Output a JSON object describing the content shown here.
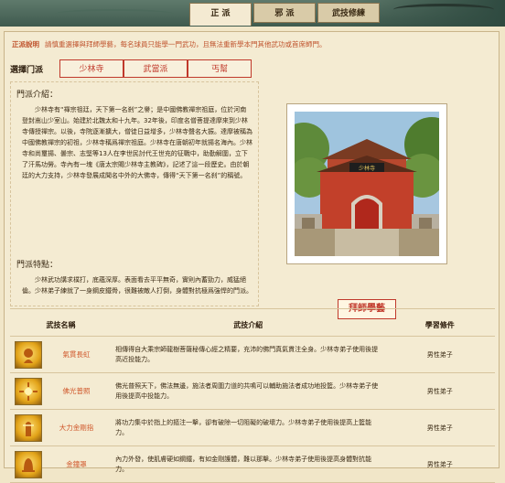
{
  "tabs": [
    {
      "label": "正 派",
      "active": true
    },
    {
      "label": "邪 派",
      "active": false
    },
    {
      "label": "武技修練",
      "active": false
    }
  ],
  "description": {
    "label": "正派說明",
    "text": "請慎重選擇與拜師學藝，每名球員只能學一門武功，且無法重新學本門其他武功或首席師門。"
  },
  "sect_selector": {
    "label": "選擇门派",
    "options": [
      "少林寺",
      "武當派",
      "丐幫"
    ]
  },
  "intro": {
    "heading": "門派介紹：",
    "body": "少林寺有“禪宗祖廷，天下第一名剎”之譽；是中國佛教禪宗祖庭，位於河南登封嵩山少室山。始建於北魏太和十九年。32年後，印度名僧菩提達摩來到少林寺傳授禪宗。以後，寺院逐漸擴大，僧徒日益增多，少林寺聲名大振。達摩被稱為中國佛教禪宗的初祖，少林寺稱爲禪宗祖庭。少林寺在唐朝初年就揚名海內。少林寺和尚璽揚、曇宗、志堅等13人在李世民討代王世充的征戰中，助勤解圍，立下了汗馬功勞。寺內有一塊《唐太宗賜少林寺主教碑》，記述了這一段歷史。由於朝廷的大力支持，少林寺發展成聞名中外的大佛寺，傳得“天下第一名刹”的稱號。"
  },
  "features": {
    "heading": "門派特點：",
    "body": "少林武功講求樸打，底蘊深厚。表面看去平平無奇，實則內蓄勁力，威猛絕倫。少林弟子練就了一身鋼皮鐵骨，很難被敵人打倒，身體對抗極爲強悍的門派。"
  },
  "apprentice_button": "拜師學藝",
  "skills_table": {
    "headers": [
      "武技名稱",
      "武技介紹",
      "學習條件"
    ],
    "rows": [
      {
        "icon": "fire-fist-icon",
        "name": "氣貫長虹",
        "intro": "相傳得自大乘宗師龍樹菩薩秘傳心經之精要，充沛的佛門真氣貫注全身。少林寺弟子使用後提高近投能力。",
        "condition": "男性弟子"
      },
      {
        "icon": "radiance-icon",
        "name": "佛光普照",
        "intro": "佛光普照天下，佛法無邊，施法者周圍力道的共鳴可以輔助施法者成功地投籃。少林寺弟子使用後提高中投能力。",
        "condition": "男性弟子"
      },
      {
        "icon": "diamond-palm-icon",
        "name": "大力金剛指",
        "intro": "將功力集中於指上的摳注一擊，卻有破除一切阻礙的破壞力。少林寺弟子使用後提高上籃能力。",
        "condition": "男性弟子"
      },
      {
        "icon": "golden-bell-icon",
        "name": "金鐘罩",
        "intro": "內力外發，使肌膚硬如鋼鐵，有如金剛護體，難以那擊。少林寺弟子使用後提高身體對抗能力。",
        "condition": "男性弟子"
      }
    ]
  }
}
